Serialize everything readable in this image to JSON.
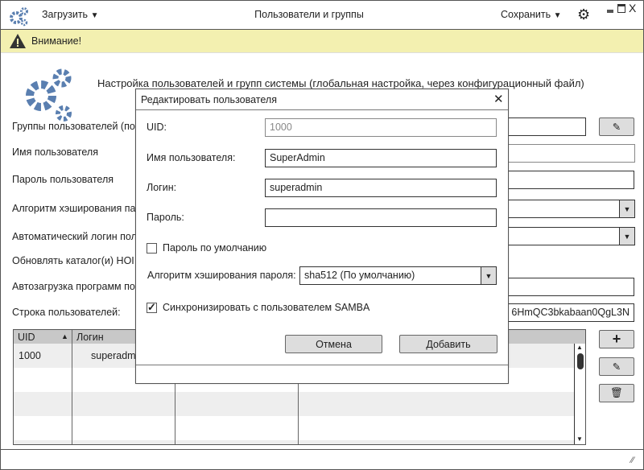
{
  "app": {
    "title": "Пользователи и группы",
    "load_menu": "Загрузить",
    "save_menu": "Сохранить"
  },
  "warning": {
    "text": "Внимание!"
  },
  "header": {
    "text": "Настройка пользователей и групп системы (глобальная настройка, через конфигурационный файл)"
  },
  "form": {
    "labels": [
      "Группы пользователей (по",
      "Имя пользователя",
      "Пароль пользователя",
      "Алгоритм хэширования па",
      "Автоматический логин пол",
      "Обновлять каталог(и) HOI",
      "Автозагрузка программ по",
      "Строка пользователей:"
    ],
    "users_string": "6HmQC3bkabaan0QgL3N"
  },
  "table": {
    "columns": [
      "UID",
      "Логин"
    ],
    "rows": [
      {
        "uid": "1000",
        "login": "superadm"
      }
    ]
  },
  "dialog": {
    "title": "Редактировать пользователя",
    "uid_label": "UID:",
    "uid_value": "1000",
    "name_label": "Имя пользователя:",
    "name_value": "SuperAdmin",
    "login_label": "Логин:",
    "login_value": "superadmin",
    "password_label": "Пароль:",
    "password_value": "",
    "default_password_label": "Пароль по умолчанию",
    "default_password_checked": false,
    "hash_label": "Алгоритм хэширования пароля:",
    "hash_value": "sha512 (По умолчанию)",
    "samba_label": "Синхронизировать с пользователем SAMBA",
    "samba_checked": true,
    "cancel": "Отмена",
    "add": "Добавить"
  },
  "colors": {
    "accent": "#5a7fb0",
    "warning_bg": "#f3f0b0"
  }
}
